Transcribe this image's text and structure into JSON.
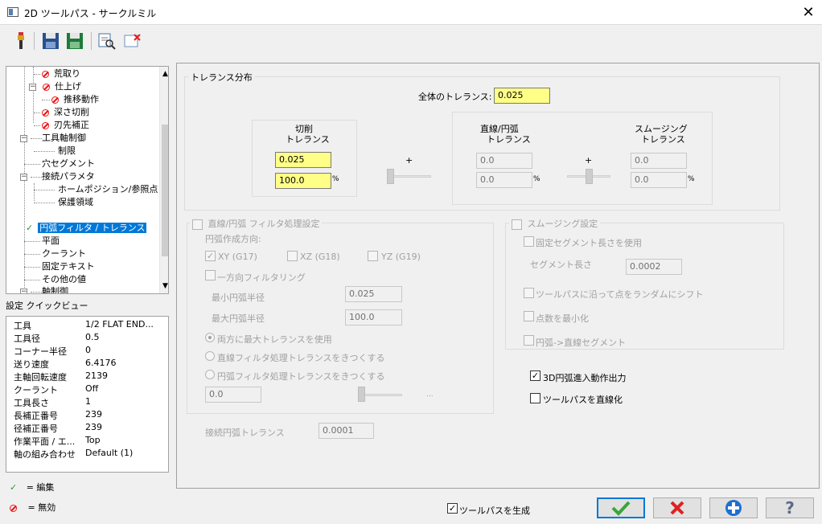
{
  "window": {
    "title": "2D ツールパス - サークルミル",
    "close_glyph": "✕"
  },
  "toolbar": {
    "icons": [
      "tool-icon",
      "save-icon",
      "save-green-icon",
      "preview-icon",
      "clear-icon"
    ]
  },
  "tree": {
    "items": [
      {
        "label": "荒取り",
        "icon": "disabled-icon"
      },
      {
        "label": "仕上げ",
        "icon": "disabled-icon"
      },
      {
        "label": "推移動作",
        "icon": "disabled-icon"
      },
      {
        "label": "深さ切削",
        "icon": "disabled-icon"
      },
      {
        "label": "刃先補正",
        "icon": "disabled-icon"
      },
      {
        "label": "工具軸制御",
        "icon": ""
      },
      {
        "label": "制限",
        "icon": ""
      },
      {
        "label": "穴セグメント",
        "icon": ""
      },
      {
        "label": "接続パラメタ",
        "icon": ""
      },
      {
        "label": "ホームポジション/参照点",
        "icon": ""
      },
      {
        "label": "保護領域",
        "icon": ""
      },
      {
        "label": "円弧フィルタ / トレランス",
        "icon": "check-icon",
        "selected": true
      },
      {
        "label": "平面",
        "icon": ""
      },
      {
        "label": "クーラント",
        "icon": ""
      },
      {
        "label": "固定テキスト",
        "icon": ""
      },
      {
        "label": "その他の値",
        "icon": ""
      },
      {
        "label": "軸制御",
        "icon": ""
      }
    ]
  },
  "quickview": {
    "title": "設定 クイックビュー",
    "rows": [
      {
        "label": "工具",
        "value": "1/2 FLAT END..."
      },
      {
        "label": "工具径",
        "value": "0.5"
      },
      {
        "label": "コーナー半径",
        "value": "0"
      },
      {
        "label": "送り速度",
        "value": "6.4176"
      },
      {
        "label": "主軸回転速度",
        "value": "2139"
      },
      {
        "label": "クーラント",
        "value": "Off"
      },
      {
        "label": "工具長さ",
        "value": "1"
      },
      {
        "label": "長補正番号",
        "value": "239"
      },
      {
        "label": "径補正番号",
        "value": "239"
      },
      {
        "label": "作業平面 / エ...",
        "value": "Top"
      },
      {
        "label": "軸の組み合わせ",
        "value": "Default (1)"
      }
    ]
  },
  "legend": {
    "edit": "= 編集",
    "disabled": "= 無効"
  },
  "tolerance": {
    "group_title": "トレランス分布",
    "total_label": "全体のトレランス:",
    "total_value": "0.025",
    "cut_title_1": "切削",
    "cut_title_2": "トレランス",
    "cut_value": "0.025",
    "cut_percent": "100.0",
    "percent_sign": "%",
    "plus": "+",
    "line_title_1": "直線/円弧",
    "line_title_2": "トレランス",
    "line_value": "0.0",
    "line_percent": "0.0",
    "smooth_title_1": "スムージング",
    "smooth_title_2": "トレランス",
    "smooth_value": "0.0",
    "smooth_percent": "0.0",
    "cut_share_fraction": 0.0,
    "smooth_share_fraction": 0.5
  },
  "arcfilter": {
    "title": "直線/円弧 フィルタ処理設定",
    "direction_label": "円弧作成方向:",
    "xy": "XY (G17)",
    "xz": "XZ (G18)",
    "yz": "YZ (G19)",
    "oneway": "一方向フィルタリング",
    "min_radius_label": "最小円弧半径",
    "min_radius_value": "0.025",
    "max_radius_label": "最大円弧半径",
    "max_radius_value": "100.0",
    "radio1": "両方に最大トレランスを使用",
    "radio2": "直線フィルタ処理トレランスをきつくする",
    "radio3": "円弧フィルタ処理トレランスをきつくする",
    "bottom_value": "0.0",
    "ellipsis": "...",
    "tangent_label": "接続円弧トレランス",
    "tangent_value": "0.0001"
  },
  "smoothing": {
    "title": "スムージング設定",
    "fixed_segment": "固定セグメント長さを使用",
    "segment_length_label": "セグメント長さ",
    "segment_length_value": "0.0002",
    "random_shift": "ツールパスに沿って点をランダムにシフト",
    "minimize_points": "点数を最小化",
    "arc_to_line": "円弧->直線セグメント"
  },
  "options": {
    "arc_3d": "3D円弧進入動作出力",
    "linearize": "ツールパスを直線化"
  },
  "footer": {
    "generate": "ツールパスを生成",
    "check_glyph": "✓"
  },
  "colors": {
    "accent": "#0078d7",
    "field_yellow": "#ffff88",
    "ok_green": "#3aa53a",
    "cancel_red": "#e02020",
    "plus_blue": "#1f6fd0"
  }
}
